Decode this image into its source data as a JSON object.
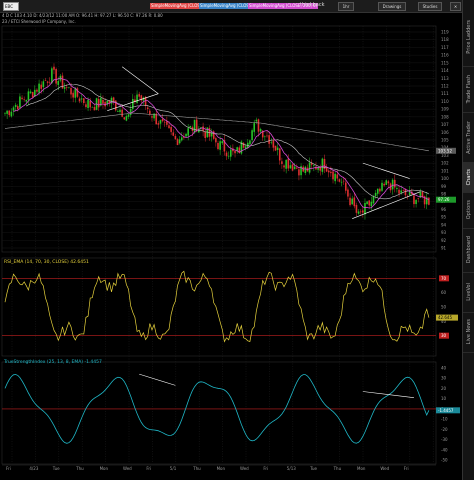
{
  "toolbar": {
    "symbol": "EBC",
    "chips": [
      {
        "text": "SimpleMovingAvg (CLOSE, 20, 0)",
        "color": "#e14646"
      },
      {
        "text": "SimpleMovingAvg (CLOSE, 50, 0)",
        "color": "#3a84c8"
      },
      {
        "text": "SimpleMovingAvg (CLOSE, 200, 0)",
        "color": "#d24dd0"
      }
    ],
    "right_label_1": "thinkback",
    "interval": "1hr",
    "drawings": "Drawings",
    "studies": "Studies",
    "close": "✕"
  },
  "status": {
    "line1": "4 D C  103 4.10  D: 4/23/12 11:00 AM   O: 96.41   H: 97.27   L: 96.50   C: 97.26   R: 0.80",
    "line2": "23 / ETCI  Sherwood IP Company, Inc."
  },
  "sidebar": {
    "tabs": [
      "Price Ladders",
      "Trade Flash",
      "Active Trader",
      "Charts",
      "Options",
      "Dashboard",
      "LiveVol",
      "Live News"
    ],
    "active_index": 3
  },
  "panes": {
    "price": {
      "ticks": [
        "119",
        "118",
        "117",
        "116",
        "115",
        "114",
        "113",
        "112",
        "111",
        "110",
        "109",
        "108",
        "107",
        "106",
        "105",
        "104",
        "103",
        "102",
        "101",
        "100",
        "99",
        "98",
        "97",
        "96",
        "95",
        "94",
        "93",
        "92",
        "91"
      ],
      "last_label_1": "103.52",
      "last_label_2": "97.26"
    },
    "rsi": {
      "title": "RSI_EMA (14, 70, 30, CLOSE)  42.6451",
      "ticks": [
        "70",
        "60",
        "50",
        "40",
        "30"
      ],
      "level_hi": "70",
      "level_lo": "30",
      "value_label": "42.645"
    },
    "tsi": {
      "title": "TrueStrengthIndex (25, 13, 8, EMA)  -1.4457",
      "ticks": [
        "40",
        "30",
        "20",
        "10",
        "0",
        "-10",
        "-20",
        "-30",
        "-40",
        "-50"
      ],
      "value_label": "-1.4457"
    }
  },
  "xaxis": {
    "labels": [
      "Fri",
      "4/23",
      "Tue",
      "Thu",
      "Mon",
      "Wed",
      "Fri",
      "5/1",
      "Thu",
      "Mon",
      "Wed",
      "Fri",
      "5/13",
      "Tue",
      "Thu",
      "Mon",
      "Wed",
      "Fri"
    ]
  },
  "colors": {
    "up": "#27c427",
    "down": "#e03030",
    "sma20": "#d34ad3",
    "sma50": "#c9c9c9",
    "sma200": "#a0a0a0",
    "rsi_line": "#e6d23c",
    "tsi_line": "#1fb8c8",
    "level": "#c02020"
  }
}
